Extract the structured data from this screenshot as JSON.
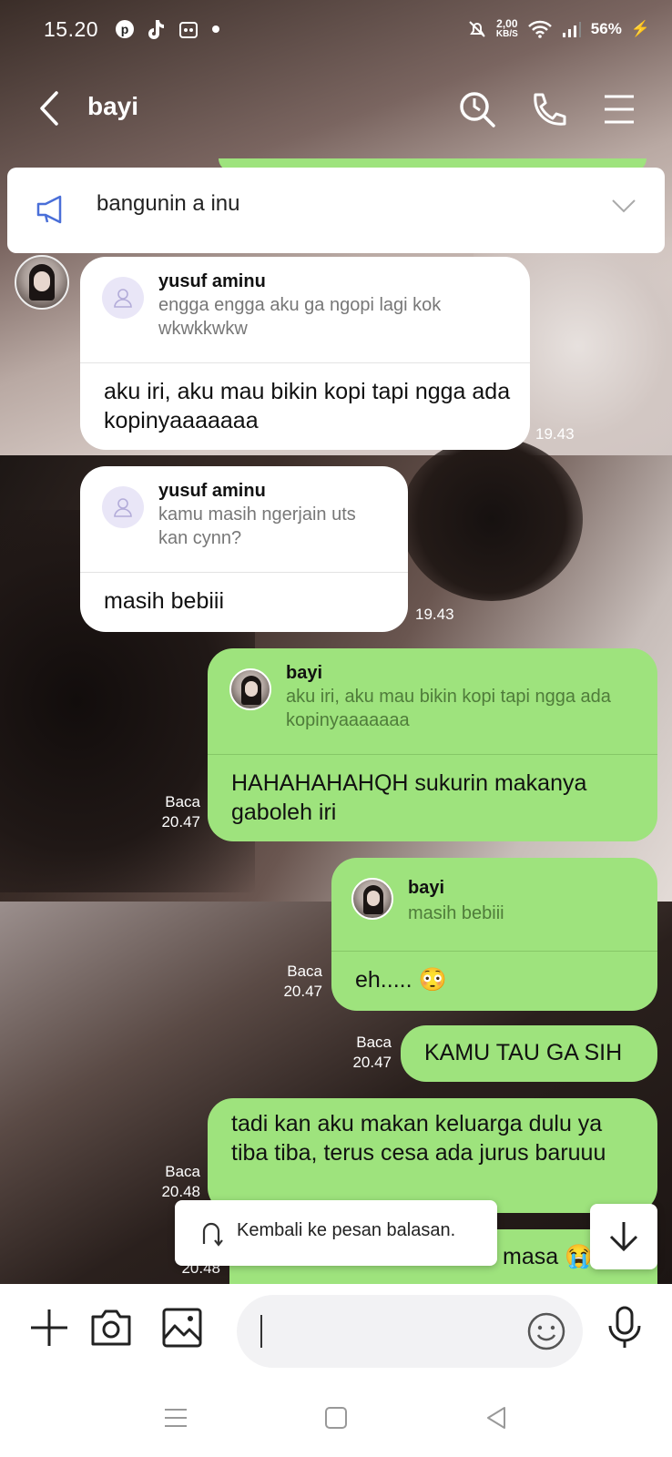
{
  "status_bar": {
    "time": "15.20",
    "speed_value": "2,00",
    "speed_unit": "KB/S",
    "battery": "56%",
    "app_icons": [
      "pinterest-icon",
      "tiktok-icon",
      "app-icon",
      "dot-icon"
    ]
  },
  "header": {
    "title": "bayi",
    "icons": [
      "back-icon",
      "search-icon",
      "call-icon",
      "menu-icon"
    ]
  },
  "announcement": {
    "text": "bangunin a inu"
  },
  "messages": [
    {
      "direction": "in",
      "reply_name": "yusuf aminu",
      "reply_quote": "engga engga aku ga ngopi lagi kok wkwkkwkw",
      "text": "aku iri, aku mau bikin kopi tapi ngga ada kopinyaaaaaaa",
      "time": "19.43"
    },
    {
      "direction": "in",
      "reply_name": "yusuf aminu",
      "reply_quote": "kamu masih ngerjain uts kan cynn?",
      "text": "masih bebiii",
      "time": "19.43"
    },
    {
      "direction": "out",
      "reply_name": "bayi",
      "reply_quote": "aku iri, aku mau bikin kopi tapi ngga ada kopinyaaaaaaa",
      "text": "HAHAHAHAHQH sukurin makanya gaboleh iri",
      "read": "Baca",
      "time": "20.47"
    },
    {
      "direction": "out",
      "reply_name": "bayi",
      "reply_quote": "masih bebiii",
      "text": "eh..... 😳",
      "read": "Baca",
      "time": "20.47"
    },
    {
      "direction": "out",
      "text": "KAMU TAU GA SIH",
      "read": "Baca",
      "time": "20.47"
    },
    {
      "direction": "out",
      "text": "tadi kan aku makan keluarga dulu ya tiba tiba, terus cesa ada jurus baruuu",
      "read": "Baca",
      "time": "20.48"
    },
    {
      "direction": "out",
      "text": "masa 😭",
      "time": "20.48"
    }
  ],
  "toast": {
    "text": "Kembali ke pesan balasan."
  },
  "input": {
    "icons": [
      "plus-icon",
      "camera-icon",
      "gallery-icon",
      "emoji-icon",
      "mic-icon"
    ],
    "value": ""
  },
  "nav": {
    "icons": [
      "recents-icon",
      "home-icon",
      "back-nav-icon"
    ]
  },
  "colors": {
    "outgoing_bubble": "#9ee37d",
    "incoming_bubble": "#ffffff",
    "accent_blue": "#4a6fd8"
  }
}
